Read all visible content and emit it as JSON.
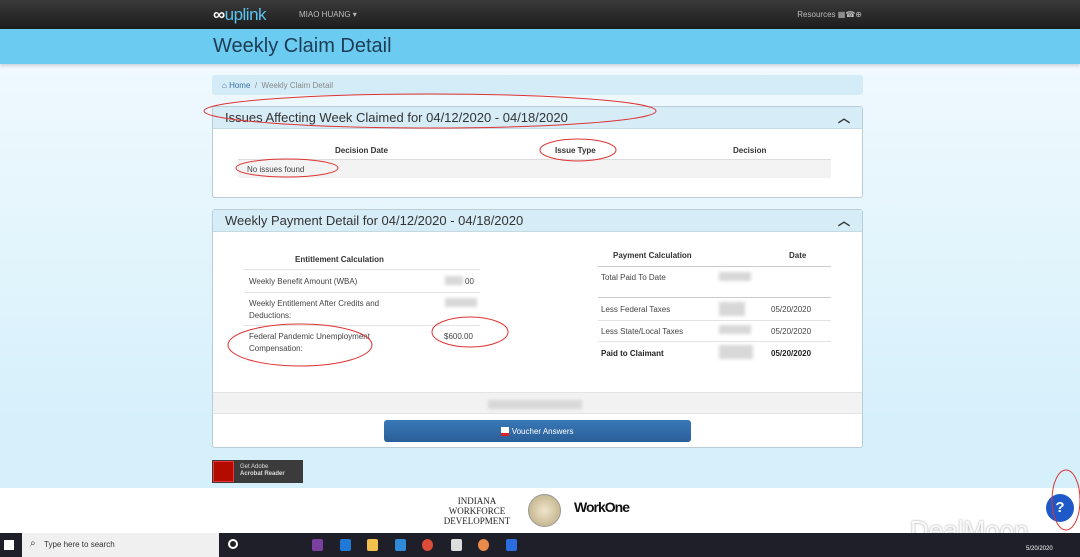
{
  "nav": {
    "logo": "uplink",
    "user": "MIAO HUANG ▾",
    "resources": "Resources"
  },
  "header": {
    "title": "Weekly Claim Detail"
  },
  "breadcrumb": {
    "home": "Home",
    "current": "Weekly Claim Detail"
  },
  "issues": {
    "title": "Issues Affecting Week Claimed for 04/12/2020 - 04/18/2020",
    "columns": [
      "Decision Date",
      "Issue Type",
      "Decision"
    ],
    "empty": "No issues found"
  },
  "payment": {
    "title": "Weekly Payment Detail for 04/12/2020 - 04/18/2020",
    "entitlement": {
      "header": "Entitlement Calculation",
      "rows": [
        {
          "label": "Weekly Benefit Amount (WBA)",
          "value": "00"
        },
        {
          "label": "Weekly Entitlement After Credits and Deductions:",
          "value": ""
        },
        {
          "label": "Federal Pandemic Unemployment Compensation:",
          "value": "$600.00"
        }
      ]
    },
    "calc": {
      "header": "Payment Calculation",
      "date_header": "Date",
      "rows": [
        {
          "label": "Total Paid To Date",
          "date": ""
        },
        {
          "label": "Less Federal Taxes",
          "date": "05/20/2020"
        },
        {
          "label": "Less State/Local Taxes",
          "date": "05/20/2020"
        },
        {
          "label": "Paid to Claimant",
          "date": "05/20/2020"
        }
      ]
    },
    "voucher_button": "Voucher Answers"
  },
  "adobe": {
    "line1": "Get Adobe",
    "line2": "Acrobat Reader"
  },
  "footer": {
    "logo1": "INDIANA WORKFORCE DEVELOPMENT",
    "logo2": "WorkOne"
  },
  "help": "?",
  "taskbar": {
    "search_placeholder": "Type here to search",
    "date": "5/20/2020"
  },
  "watermark": "DealMoon"
}
